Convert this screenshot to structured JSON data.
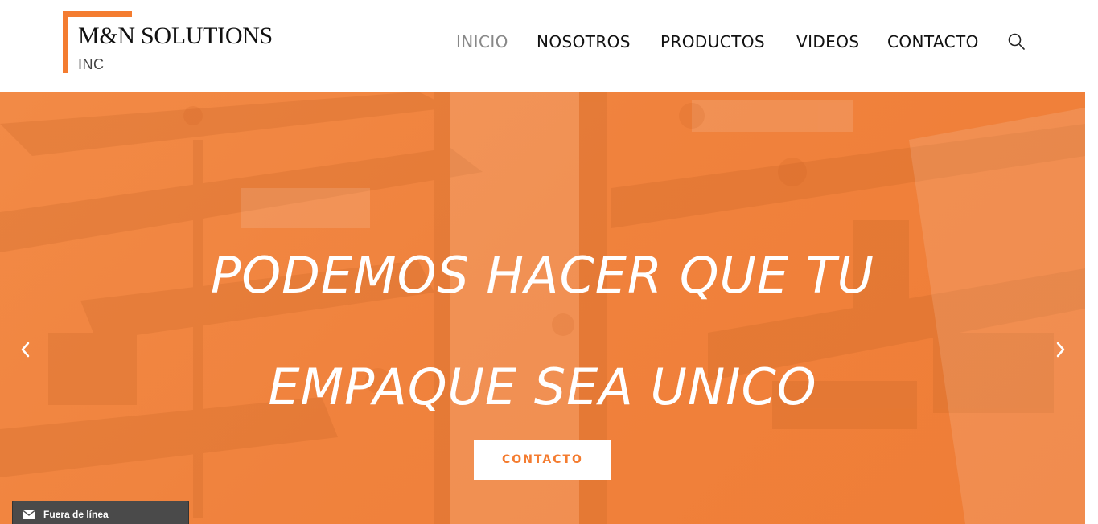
{
  "brand": {
    "name": "M&N SOLUTIONS",
    "suffix": "INC",
    "accent_color": "#f47c30"
  },
  "nav": {
    "items": [
      {
        "label": "INICIO",
        "active": true
      },
      {
        "label": "NOSOTROS",
        "active": false
      },
      {
        "label": "PRODUCTOS",
        "active": false
      },
      {
        "label": "VIDEOS",
        "active": false
      },
      {
        "label": "CONTACTO",
        "active": false
      }
    ],
    "search_icon": "search-icon"
  },
  "hero": {
    "line1": "PODEMOS HACER QUE TU",
    "line2": "EMPAQUE SEA UNICO",
    "cta_label": "CONTACTO",
    "prev_icon": "chevron-left-icon",
    "next_icon": "chevron-right-icon",
    "overlay_color": "#f47c30"
  },
  "chat": {
    "status": "Fuera de línea",
    "icon": "envelope-icon"
  }
}
